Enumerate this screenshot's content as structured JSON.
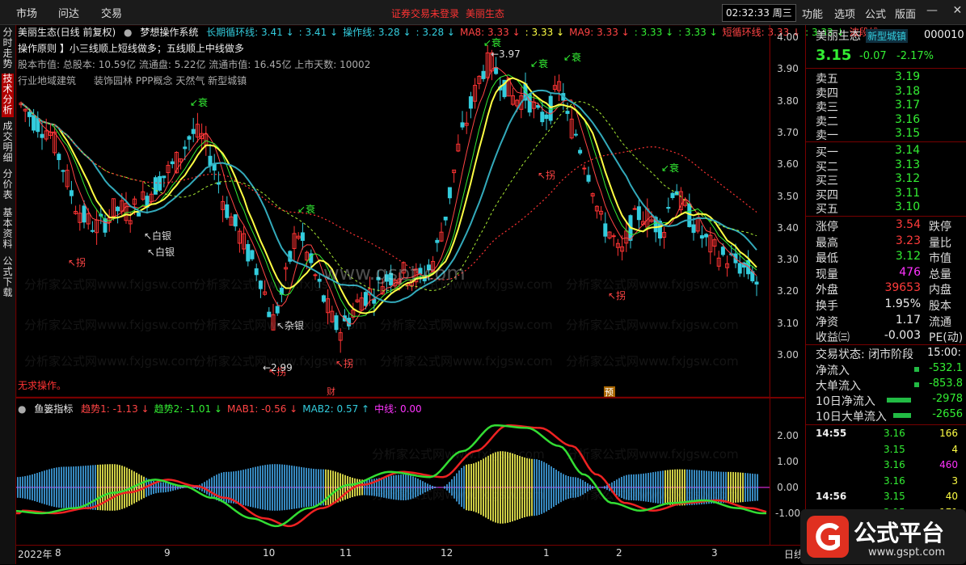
{
  "topbar": {
    "menus": [
      "市场",
      "问达",
      "交易"
    ],
    "alert1": "证券交易未登录",
    "alert2": "美丽生态",
    "time": "02:32:33",
    "weekday": "周三",
    "right_menus": [
      "功能",
      "选项",
      "公式",
      "版面"
    ]
  },
  "left_tabs": [
    "分时走势",
    "技术分析",
    "成交明细",
    "分价表",
    "基本资料",
    "公式下载"
  ],
  "chart_header": {
    "stock": "美丽生态(日线 前复权)",
    "formula": "梦想操作系统",
    "items": [
      {
        "label": "长期循环线: 3.41",
        "arrow": "↓",
        "color": "#33ccdd"
      },
      {
        "label": ": 3.41",
        "arrow": "↓",
        "color": "#33ccdd"
      },
      {
        "label": "操作线: 3.28",
        "arrow": "↓",
        "color": "#33ccdd"
      },
      {
        "label": ": 3.28",
        "arrow": "↓",
        "color": "#33ccdd"
      },
      {
        "label": "MA8: 3.33",
        "arrow": "↓",
        "color": "#ff4444"
      },
      {
        "label": ": 3.33",
        "arrow": "↓",
        "color": "#ffff44"
      },
      {
        "label": "MA9: 3.33",
        "arrow": "↓",
        "color": "#ff4444"
      },
      {
        "label": ": 3.33",
        "arrow": "↓",
        "color": "#33ee33"
      },
      {
        "label": ": 3.33",
        "arrow": "↓",
        "color": "#33ee33"
      },
      {
        "label": "短循环线: 3.33",
        "arrow": "↓",
        "color": "#ff4444"
      },
      {
        "label": ": 3.33",
        "arrow": "↓",
        "color": "#33ee33"
      },
      {
        "label": "波段线",
        "arrow": "◇",
        "color": "#ff4444"
      }
    ]
  },
  "info": {
    "rule": "操作原则 】小三线顺上短线做多；五线顺上中线做多",
    "market": "股本市值: 总股本: 10.59亿 流通盘: 5.22亿 流通市值: 16.45亿 上市天数: 10002",
    "industry": "行业地域建筑",
    "concept": "装饰园林 PPP概念 天然气 新型城镇"
  },
  "no_op": "无求操作。",
  "annotations": [
    {
      "text": "↙衰"
    },
    {
      "text": "↙衰"
    },
    {
      "text": "↙衰"
    },
    {
      "text": "↙衰"
    },
    {
      "text": "↙衰"
    },
    {
      "text": "↙衰"
    },
    {
      "text": "↖拐"
    },
    {
      "text": "↖拐"
    },
    {
      "text": "↖拐"
    },
    {
      "text": "↖拐"
    },
    {
      "text": "↖拐"
    },
    {
      "text": "↖白银"
    },
    {
      "text": "↖白银"
    },
    {
      "text": "↖杂银"
    },
    {
      "text": "←2.99"
    },
    {
      "text": "←3.97"
    }
  ],
  "markers": {
    "cai": "财",
    "yu": "预"
  },
  "watermark": "分析家公式网www.fxjgsw.com",
  "gspt": "www.gspt.com",
  "price_axis": [
    "4.00",
    "3.90",
    "3.80",
    "3.70",
    "3.60",
    "3.50",
    "3.40",
    "3.30",
    "3.20",
    "3.10",
    "3.00"
  ],
  "ind_axis": [
    "2.00",
    "1.00",
    "0.00",
    "-1.00"
  ],
  "x_labels": [
    "2022年",
    "8",
    "9",
    "10",
    "11",
    "12",
    "1",
    "2",
    "3",
    "日线"
  ],
  "indicator": {
    "name": "鱼篓指标",
    "items": [
      {
        "label": "趋势1: -1.13",
        "arrow": "↓",
        "color": "#ff4444"
      },
      {
        "label": "趋势2: -1.01",
        "arrow": "↓",
        "color": "#33ee33"
      },
      {
        "label": "MAB1: -0.56",
        "arrow": "↓",
        "color": "#ff4444"
      },
      {
        "label": "MAB2: 0.57",
        "arrow": "↑",
        "color": "#33ccdd"
      },
      {
        "label": "中线: 0.00",
        "arrow": "",
        "color": "#ff33ff"
      }
    ]
  },
  "quote": {
    "name": "美丽生态",
    "tag": "新型城镇",
    "code": "000010",
    "price": "3.15",
    "change": "-0.07",
    "pct": "-2.17%",
    "asks": [
      {
        "label": "卖五",
        "price": "3.19"
      },
      {
        "label": "卖四",
        "price": "3.18"
      },
      {
        "label": "卖三",
        "price": "3.17"
      },
      {
        "label": "卖二",
        "price": "3.16"
      },
      {
        "label": "卖一",
        "price": "3.15"
      }
    ],
    "bids": [
      {
        "label": "买一",
        "price": "3.14"
      },
      {
        "label": "买二",
        "price": "3.13"
      },
      {
        "label": "买三",
        "price": "3.12"
      },
      {
        "label": "买四",
        "price": "3.11"
      },
      {
        "label": "买五",
        "price": "3.10"
      }
    ],
    "stats": [
      {
        "l1": "涨停",
        "v1": "3.54",
        "c1": "red",
        "r1": "跌停"
      },
      {
        "l1": "最高",
        "v1": "3.23",
        "c1": "red",
        "r1": "量比"
      },
      {
        "l1": "最低",
        "v1": "3.12",
        "c1": "green",
        "r1": "市值"
      },
      {
        "l1": "现量",
        "v1": "476",
        "c1": "magenta",
        "r1": "总量"
      },
      {
        "l1": "外盘",
        "v1": "39653",
        "c1": "red",
        "r1": "内盘"
      },
      {
        "l1": "换手",
        "v1": "1.95%",
        "c1": "white",
        "r1": "股本"
      },
      {
        "l1": "净资",
        "v1": "1.17",
        "c1": "white",
        "r1": "流通"
      },
      {
        "l1": "收益㈢",
        "v1": "-0.003",
        "c1": "white",
        "r1": "PE(动)"
      }
    ],
    "trade_state": "交易状态: 闭市阶段",
    "trade_time": "15:00:",
    "flows": [
      {
        "label": "净流入",
        "value": "-532.1"
      },
      {
        "label": "大单流入",
        "value": "-853.8"
      },
      {
        "label": "10日净流入",
        "value": "-2978"
      },
      {
        "label": "10日大单流入",
        "value": "-2656"
      }
    ],
    "ticks": [
      {
        "time": "14:55",
        "price": "3.16",
        "vol": "166",
        "vc": "yellow"
      },
      {
        "time": "",
        "price": "3.15",
        "vol": "4",
        "vc": "yellow"
      },
      {
        "time": "",
        "price": "3.16",
        "vol": "460",
        "vc": "magenta"
      },
      {
        "time": "",
        "price": "3.16",
        "vol": "3",
        "vc": "yellow"
      },
      {
        "time": "14:56",
        "price": "3.15",
        "vol": "40",
        "vc": "yellow"
      },
      {
        "time": "",
        "price": "3.15",
        "vol": "171",
        "vc": "yellow"
      }
    ]
  },
  "logo": {
    "title": "公式平台",
    "url": "www.gspt.com"
  },
  "colors": {
    "up": "#ff3333",
    "down": "#33ccdd",
    "yellow": "#ffff44",
    "green": "#33ee33"
  }
}
